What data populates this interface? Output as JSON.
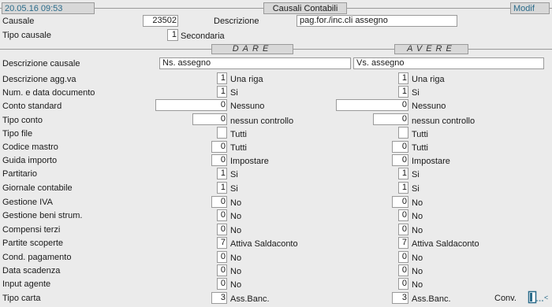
{
  "header": {
    "datetime": "20.05.16 09:53",
    "title": "Causali Contabili",
    "mode": "Modif"
  },
  "top": {
    "causale_label": "Causale",
    "causale_value": "23502",
    "descrizione_label": "Descrizione",
    "descrizione_value": "pag.for./inc.cli assegno",
    "tipo_causale_label": "Tipo causale",
    "tipo_causale_value": "1",
    "tipo_causale_desc": "Secondaria"
  },
  "sections": {
    "dare": "DARE",
    "avere": "AVERE"
  },
  "rows": [
    {
      "label": "Descrizione causale",
      "dare": {
        "value": "Ns. assegno",
        "desc": ""
      },
      "avere": {
        "value": "Vs. assegno",
        "desc": ""
      }
    },
    {
      "label": "Descrizione agg.va",
      "dare": {
        "value": "1",
        "desc": "Una riga"
      },
      "avere": {
        "value": "1",
        "desc": "Una riga"
      }
    },
    {
      "label": "Num. e data documento",
      "dare": {
        "value": "1",
        "desc": "Si"
      },
      "avere": {
        "value": "1",
        "desc": "Si"
      }
    },
    {
      "label": "Conto standard",
      "dare": {
        "value": "0",
        "desc": "Nessuno"
      },
      "avere": {
        "value": "0",
        "desc": "Nessuno"
      }
    },
    {
      "label": "Tipo conto",
      "dare": {
        "value": "0",
        "desc": "nessun controllo"
      },
      "avere": {
        "value": "0",
        "desc": "nessun controllo"
      }
    },
    {
      "label": "Tipo file",
      "dare": {
        "value": "",
        "desc": "Tutti"
      },
      "avere": {
        "value": "",
        "desc": "Tutti"
      }
    },
    {
      "label": "Codice mastro",
      "dare": {
        "value": "0",
        "desc": "Tutti"
      },
      "avere": {
        "value": "0",
        "desc": "Tutti"
      }
    },
    {
      "label": "Guida importo",
      "dare": {
        "value": "0",
        "desc": "Impostare"
      },
      "avere": {
        "value": "0",
        "desc": "Impostare"
      }
    },
    {
      "label": "Partitario",
      "dare": {
        "value": "1",
        "desc": "Si"
      },
      "avere": {
        "value": "1",
        "desc": "Si"
      }
    },
    {
      "label": "Giornale contabile",
      "dare": {
        "value": "1",
        "desc": "Si"
      },
      "avere": {
        "value": "1",
        "desc": "Si"
      }
    },
    {
      "label": "Gestione IVA",
      "dare": {
        "value": "0",
        "desc": "No"
      },
      "avere": {
        "value": "0",
        "desc": "No"
      }
    },
    {
      "label": "Gestione beni strum.",
      "dare": {
        "value": "0",
        "desc": "No"
      },
      "avere": {
        "value": "0",
        "desc": "No"
      }
    },
    {
      "label": "Compensi terzi",
      "dare": {
        "value": "0",
        "desc": "No"
      },
      "avere": {
        "value": "0",
        "desc": "No"
      }
    },
    {
      "label": "Partite scoperte",
      "dare": {
        "value": "7",
        "desc": "Attiva Saldaconto"
      },
      "avere": {
        "value": "7",
        "desc": "Attiva Saldaconto"
      }
    },
    {
      "label": "Cond. pagamento",
      "dare": {
        "value": "0",
        "desc": "No"
      },
      "avere": {
        "value": "0",
        "desc": "No"
      }
    },
    {
      "label": "Data scadenza",
      "dare": {
        "value": "0",
        "desc": "No"
      },
      "avere": {
        "value": "0",
        "desc": "No"
      }
    },
    {
      "label": "Input agente",
      "dare": {
        "value": "0",
        "desc": "No"
      },
      "avere": {
        "value": "0",
        "desc": "No"
      }
    },
    {
      "label": "Tipo carta",
      "dare": {
        "value": "3",
        "desc": "Ass.Banc."
      },
      "avere": {
        "value": "3",
        "desc": "Ass.Banc."
      }
    }
  ],
  "footer": {
    "conv_label": "Conv.",
    "conv_icon": "conversion-icon"
  },
  "colors": {
    "background": "#ebebeb",
    "header_text": "#2a6b8a",
    "field_background": "#ffffff",
    "border": "#9a9a9a"
  }
}
